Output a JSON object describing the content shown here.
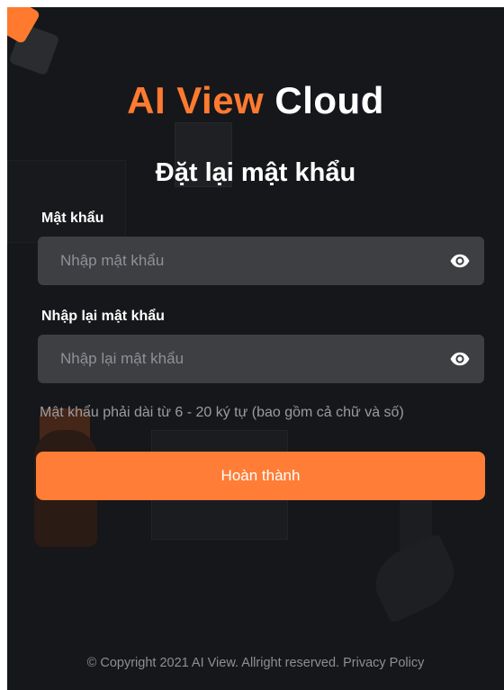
{
  "brand": {
    "part1": "AI View",
    "part2": "Cloud"
  },
  "page": {
    "title": "Đặt lại mật khẩu"
  },
  "form": {
    "password_label": "Mật khẩu",
    "password_placeholder": "Nhập mật khẩu",
    "confirm_label": "Nhập lại mật khẩu",
    "confirm_placeholder": "Nhập lại mật khẩu",
    "hint": "Mật khẩu phải dài từ  6 - 20 ký tự (bao gồm cả chữ và số)",
    "submit_label": "Hoàn thành",
    "show_password_icon": "eye-icon"
  },
  "footer": {
    "copyright": "© Copyright 2021 AI View. Allright reserved.",
    "privacy_link": "Privacy Policy"
  },
  "colors": {
    "background": "#16171a",
    "accent": "#ff7a30",
    "input_bg": "#3d3f43",
    "button": "#ff7d36"
  }
}
